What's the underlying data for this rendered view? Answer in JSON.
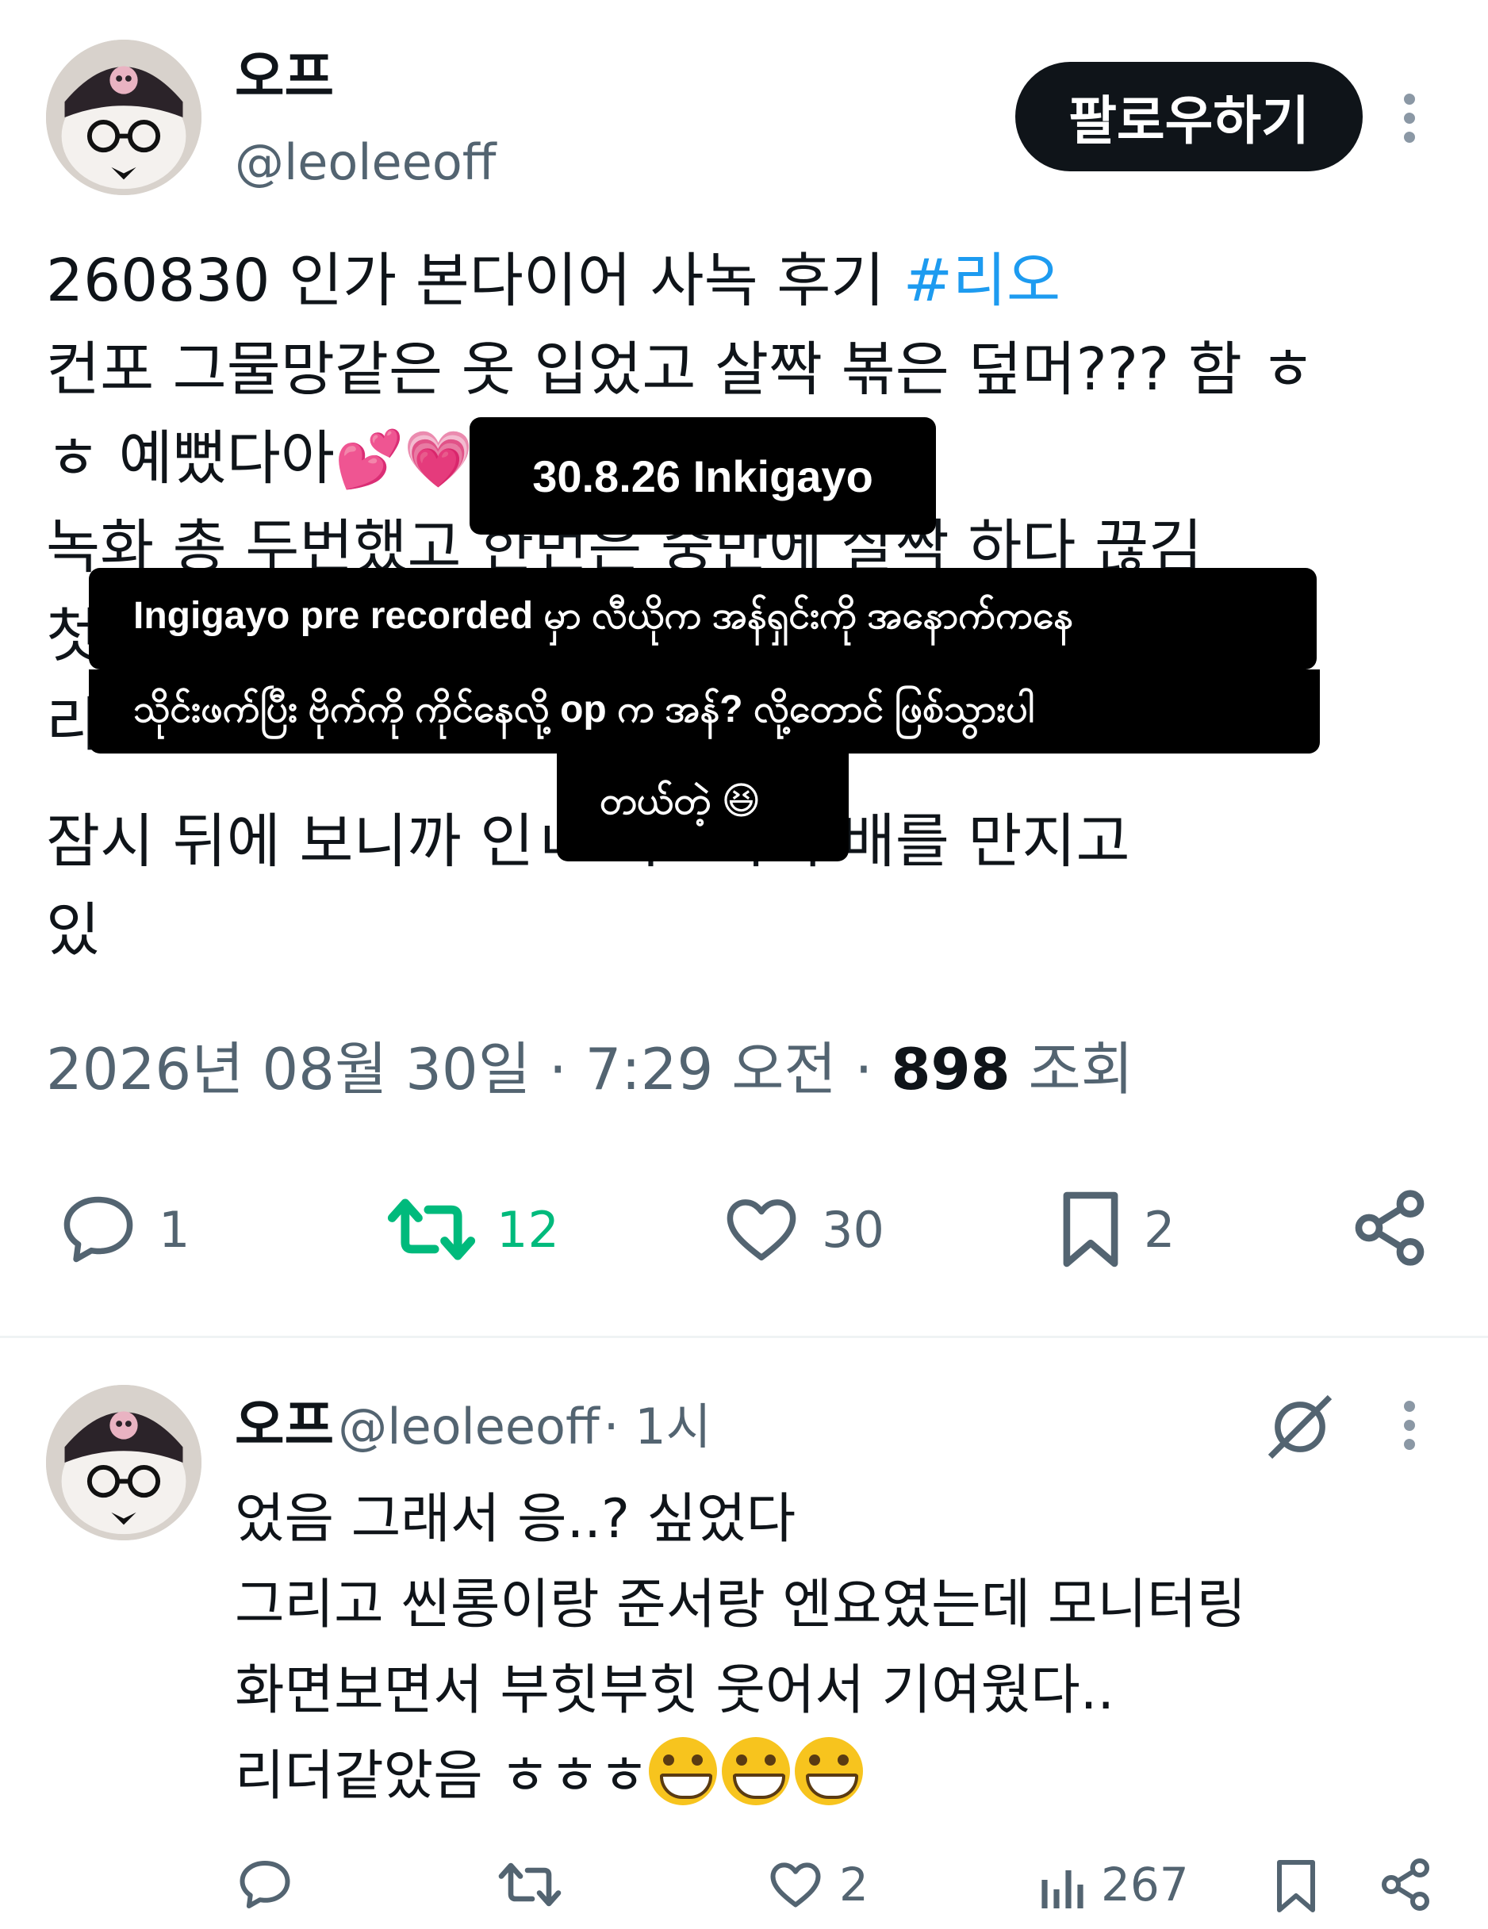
{
  "tweet": {
    "author_name": "오프",
    "author_handle": "@leoleeoff",
    "follow_label": "팔로우하기",
    "line1": "260830 인가 본다이어 사녹 후기 ",
    "hashtag": "#리오",
    "line2": "컨포 그물망같은 옷 입었고 살짝 볶은 덮머??? 함 ㅎ",
    "line3": "ㅎ 예뻤다아",
    "line3_emoji": "💕💗",
    "line4": "녹화 총 두번했고 한번은 중반에 살짝 하다 끊김",
    "line5": "첫",
    "line6": "리오는... 중간이랑 끝 즈음.. (?)",
    "line7": "잠시 뒤에 보니까 인ㄴ                 허그하며 배를 만지고",
    "line8": "있",
    "date": "2026년 08월 30일 · 7:29 오전 ·",
    "views_count": "898",
    "views_label": "조회",
    "reply_count": "1",
    "retweet_count": "12",
    "like_count": "30",
    "bookmark_count": "2"
  },
  "overlays": {
    "date_caption": "30.8.26 Inkigayo",
    "translation_line1": "Ingigayo pre recorded မှာ လီယိုက  အန်ရှင်းကို အနောက်ကနေ",
    "translation_line2": "သိုင်းဖက်ပြီး ဗိုက်ကို ကိုင်နေလို့ op က  အန်? လို့တောင် ဖြစ်သွားပါ",
    "translation_line3": "တယ်တဲ့ 😆"
  },
  "reply": {
    "author_name": "오프",
    "author_handle": "@leoleeoff",
    "time": "· 1시",
    "line1": "었음 그래서 응..? 싶었다",
    "line2": "그리고 씬롱이랑 준서랑 엔요였는데 모니터링",
    "line3": "화면보면서 부힛부힛 웃어서 기여웠다..",
    "line4": "리더같았음 ㅎㅎㅎ",
    "like_count": "2",
    "views_count": "267"
  },
  "colors": {
    "accent": "#1d9bf0",
    "retweet_green": "#00ba7c",
    "secondary_text": "#536471"
  },
  "icons": [
    "reply-icon",
    "retweet-icon",
    "like-icon",
    "bookmark-icon",
    "share-icon",
    "more-icon",
    "grok-icon",
    "views-icon"
  ]
}
